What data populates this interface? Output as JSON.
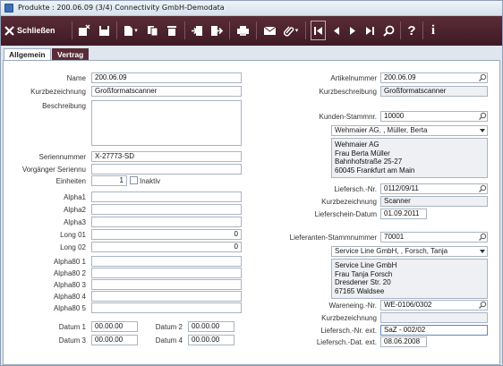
{
  "window": {
    "title": "Produkte : 200.06.09 (3/4) Connectivity GmbH-Demodata"
  },
  "toolbar": {
    "close_label": "Schließen"
  },
  "tabs": [
    {
      "label": "Allgemein",
      "active": true
    },
    {
      "label": "Vertrag",
      "active": false
    }
  ],
  "left": {
    "name": {
      "label": "Name",
      "value": "200.06.09"
    },
    "kurzbezeichnung": {
      "label": "Kurzbezeichnung",
      "value": "Großformatscanner"
    },
    "beschreibung": {
      "label": "Beschreibung",
      "value": ""
    },
    "seriennummer": {
      "label": "Seriennummer",
      "value": "X-27773-SD"
    },
    "vorgaenger": {
      "label": "Vorgänger Seriennu",
      "value": ""
    },
    "einheiten": {
      "label": "Einheiten",
      "value": "1"
    },
    "inaktiv": {
      "label": "Inaktiv",
      "checked": false
    },
    "alpha": [
      {
        "label": "Alpha1",
        "value": ""
      },
      {
        "label": "Alpha2",
        "value": ""
      },
      {
        "label": "Alpha3",
        "value": ""
      }
    ],
    "long": [
      {
        "label": "Long 01",
        "value": "0"
      },
      {
        "label": "Long 02",
        "value": "0"
      }
    ],
    "alpha80": [
      {
        "label": "Alpha80 1",
        "value": ""
      },
      {
        "label": "Alpha80 2",
        "value": ""
      },
      {
        "label": "Alpha80 3",
        "value": ""
      },
      {
        "label": "Alpha80 4",
        "value": ""
      },
      {
        "label": "Alpha80 5",
        "value": ""
      }
    ],
    "datum": [
      {
        "label": "Datum 1",
        "value": "00.00.00"
      },
      {
        "label": "Datum 2",
        "value": "00.00.00"
      },
      {
        "label": "Datum 3",
        "value": "00.00.00"
      },
      {
        "label": "Datum 4",
        "value": "00.00.00"
      }
    ]
  },
  "right": {
    "artikelnummer": {
      "label": "Artikelnummer",
      "value": "200.06.09"
    },
    "kurzbeschreibung": {
      "label": "Kurzbeschreibung",
      "value": "Großformatscanner"
    },
    "kunden": {
      "label": "Kunden-Stammnr.",
      "value": "10000",
      "combo": "Wehmaier AG, , Müller, Berta",
      "address": [
        "Wehmaier AG",
        "Frau Berta Müller",
        "Bahnhofstraße 25-27",
        "60045 Frankfurt am Main"
      ]
    },
    "lieferschnr": {
      "label": "Liefersch.-Nr.",
      "value": "0112/09/11"
    },
    "kurzbezeichnung": {
      "label": "Kurzbezeichnung",
      "value": "Scanner"
    },
    "lieferscheindatum": {
      "label": "Lieferschein-Datum",
      "value": "01.09.2011"
    },
    "lieferanten": {
      "label": "Lieferanten-Stammnummer",
      "value": "70001",
      "combo": "Service Line GmbH, , Forsch, Tanja",
      "address": [
        "Service Line GmbH",
        "Frau Tanja Forsch",
        "Dresdener Str. 20",
        "67165 Waldsee"
      ]
    },
    "wareneingnr": {
      "label": "Wareneing.-Nr.",
      "value": "WE-0106/0302"
    },
    "kurzbezeichnung2": {
      "label": "Kurzbezeichnung",
      "value": ""
    },
    "lieferschnrext": {
      "label": "Liefersch.-Nr. ext.",
      "value": "SaZ - 002/02"
    },
    "lieferschdatext": {
      "label": "Liefersch.-Dat. ext.",
      "value": "08.06.2008"
    }
  },
  "colors": {
    "toolbar": "#4a2230",
    "tab_inactive": "#5a2c38",
    "panel": "#ffffff",
    "field_readonly": "#eef0f3"
  }
}
